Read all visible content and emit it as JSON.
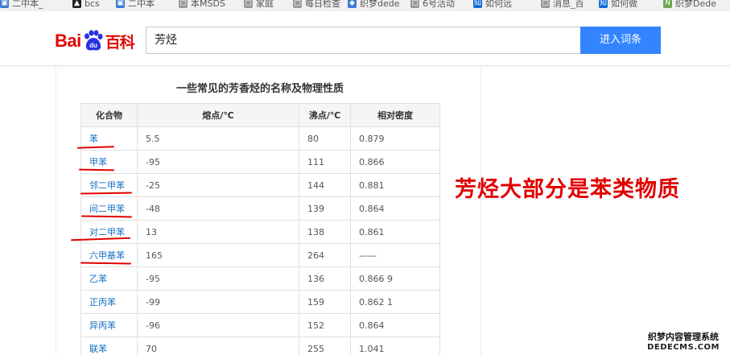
{
  "bookmarks": [
    {
      "label": "二中本_",
      "icon": "doc-icon",
      "color": "#3a7bd5"
    },
    {
      "label": "bcs",
      "icon": "warning-icon",
      "color": "#222222"
    },
    {
      "label": "二中本",
      "icon": "doc-icon",
      "color": "#3a7bd5"
    },
    {
      "label": "本MSDS",
      "icon": "page-icon",
      "color": "#999999"
    },
    {
      "label": "家庭",
      "icon": "page-icon",
      "color": "#999999"
    },
    {
      "label": "每日检查",
      "icon": "page-icon",
      "color": "#999999"
    },
    {
      "label": "织梦dede",
      "icon": "dede-icon",
      "color": "#3a7bd5"
    },
    {
      "label": "6号活动",
      "icon": "page-icon",
      "color": "#999999"
    },
    {
      "label": "如何远",
      "icon": "zhihu-icon",
      "color": "#0e6bd8"
    },
    {
      "label": "消息_百",
      "icon": "page-icon",
      "color": "#999999"
    },
    {
      "label": "如何做",
      "icon": "zhihu-icon",
      "color": "#0e6bd8"
    },
    {
      "label": "织梦Dede",
      "icon": "n-icon",
      "color": "#6aa84f"
    }
  ],
  "header": {
    "logo_bai": "Bai",
    "logo_du": "du",
    "logo_baike": "百科",
    "search_value": "芳烃",
    "search_button": "进入词条",
    "brand_red": "#e10601",
    "button_blue": "#3385ff"
  },
  "table": {
    "title": "一些常见的芳香烃的名称及物理性质",
    "headers": [
      "化合物",
      "熔点/℃",
      "沸点/℃",
      "相对密度"
    ],
    "rows": [
      [
        "苯",
        "5.5",
        "80",
        "0.879"
      ],
      [
        "甲苯",
        "-95",
        "111",
        "0.866"
      ],
      [
        "邻二甲苯",
        "-25",
        "144",
        "0.881"
      ],
      [
        "间二甲苯",
        "-48",
        "139",
        "0.864"
      ],
      [
        "对二甲苯",
        "13",
        "138",
        "0.861"
      ],
      [
        "六甲基苯",
        "165",
        "264",
        "——"
      ],
      [
        "乙苯",
        "-95",
        "136",
        "0.866 9"
      ],
      [
        "正丙苯",
        "-99",
        "159",
        "0.862 1"
      ],
      [
        "异丙苯",
        "-96",
        "152",
        "0.864"
      ],
      [
        "联苯",
        "70",
        "255",
        "1.041"
      ]
    ]
  },
  "annotation": {
    "text": "芳烃大部分是苯类物质",
    "color": "#e00000"
  },
  "watermark": {
    "line1": "织梦内容管理系统",
    "line2": "DEDECMS.COM"
  }
}
